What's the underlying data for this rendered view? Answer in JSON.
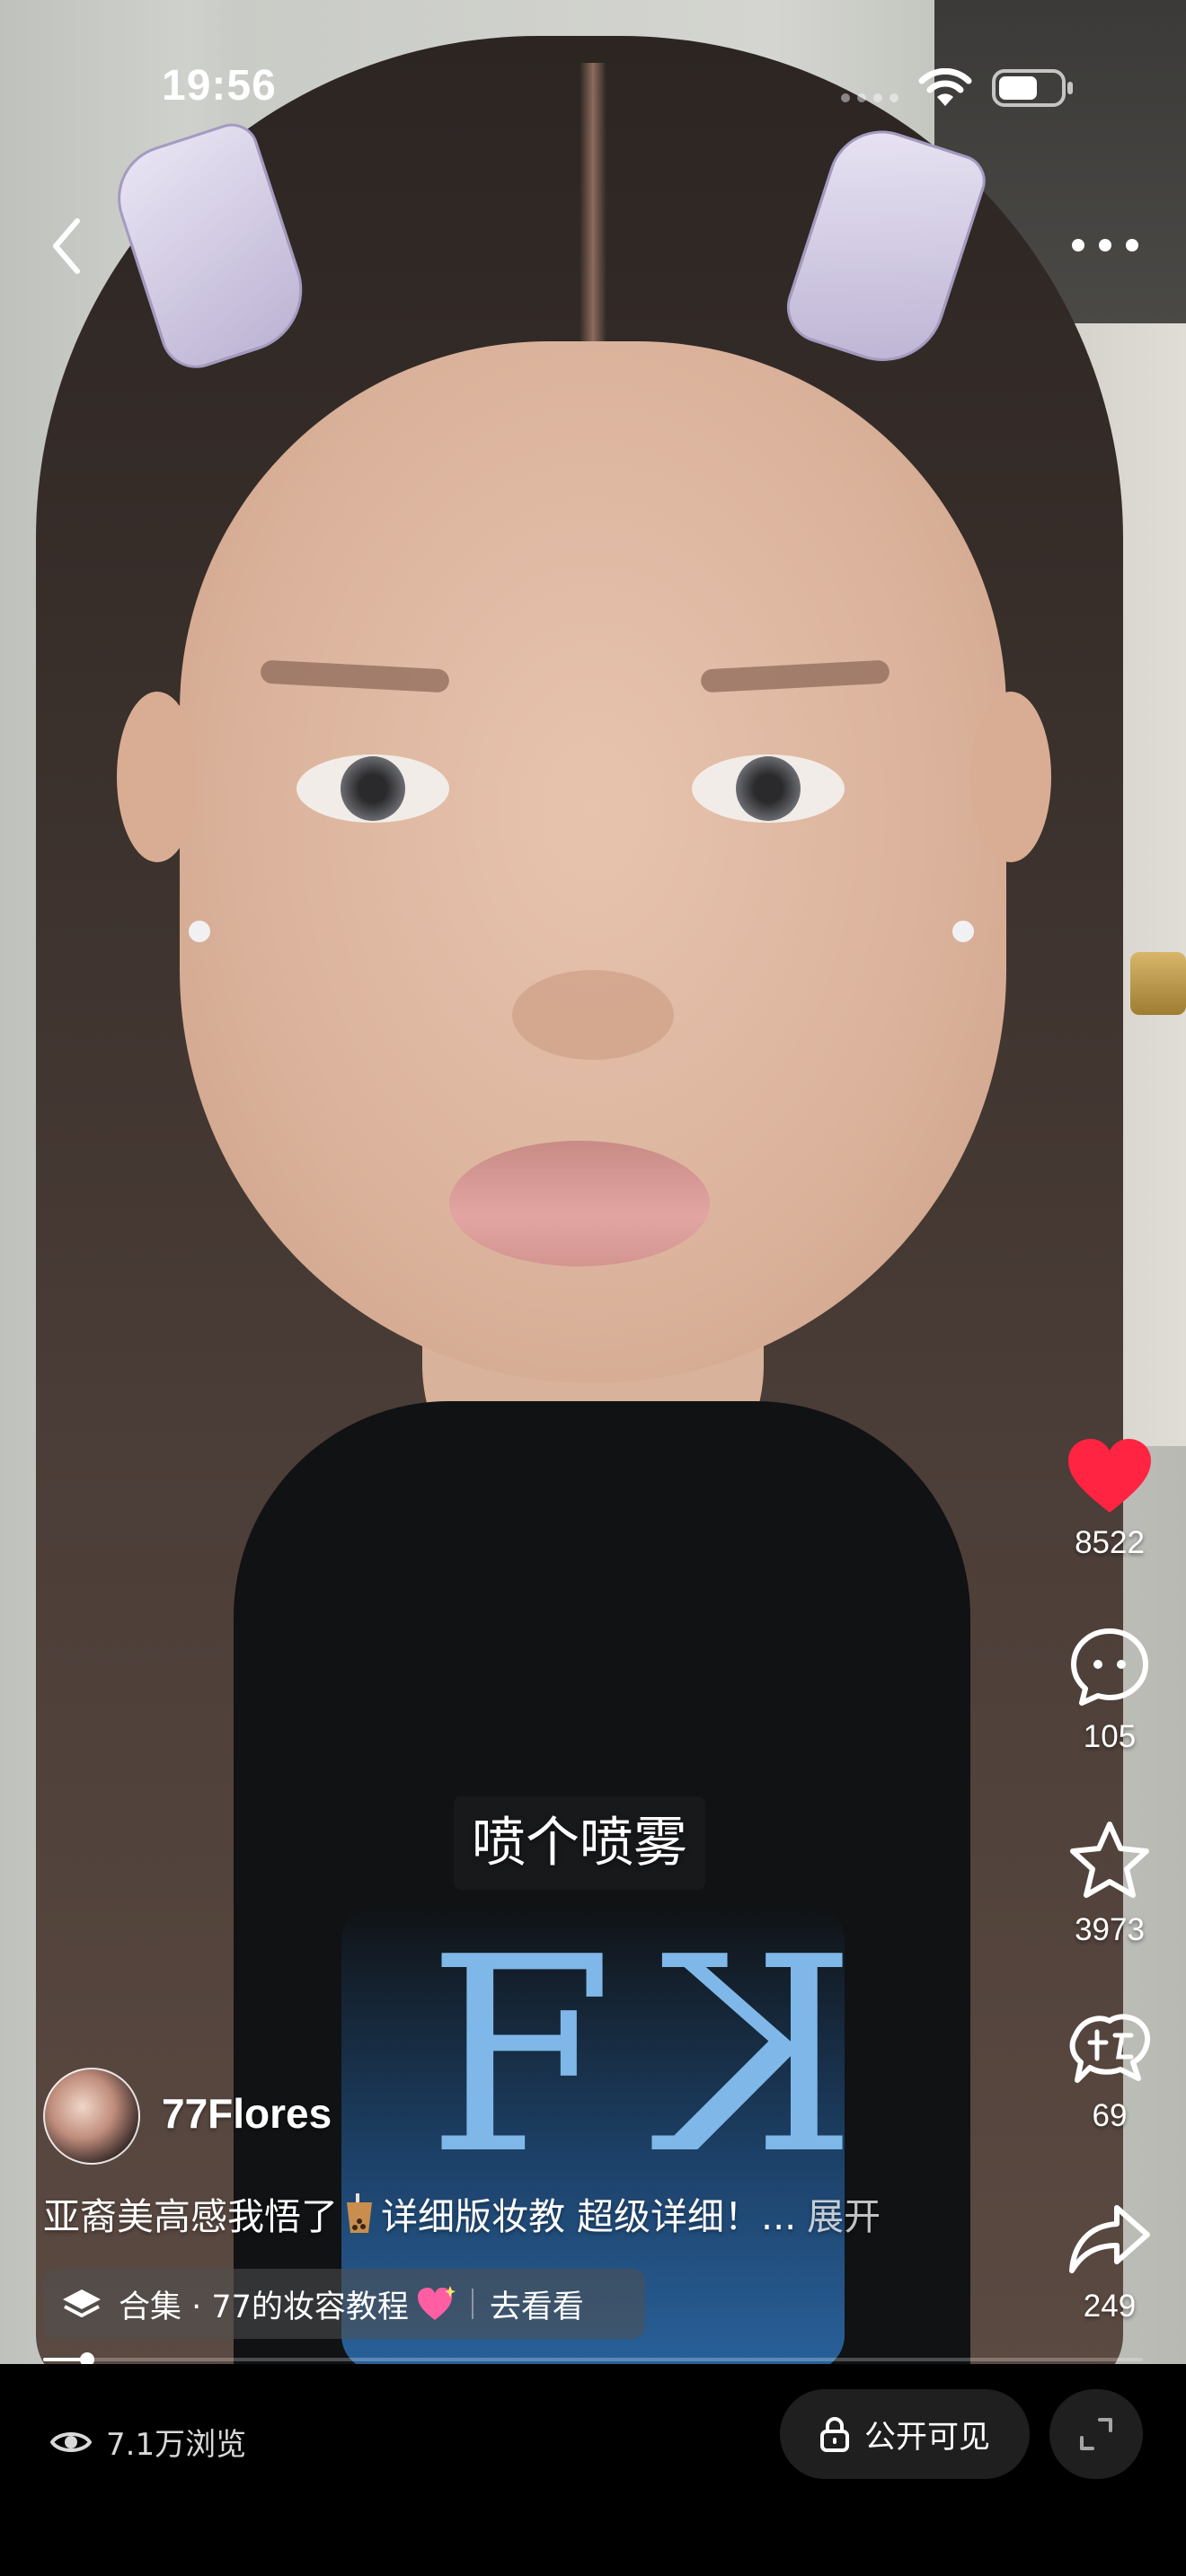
{
  "status_bar": {
    "time": "19:56",
    "icons": [
      "wifi-icon",
      "battery-icon"
    ]
  },
  "nav": {
    "back_icon": "chevron-left-icon",
    "more_icon": "more-horizontal-icon"
  },
  "actions": {
    "like": {
      "icon": "heart-icon",
      "count": "8522",
      "color": "#ff2442",
      "liked": true
    },
    "comment": {
      "icon": "comment-bubble-icon",
      "count": "105"
    },
    "favorite": {
      "icon": "star-icon",
      "count": "3973"
    },
    "remix": {
      "icon": "remix-icon",
      "count": "69"
    },
    "share": {
      "icon": "share-arrow-icon",
      "count": "249"
    }
  },
  "video": {
    "subtitle": "喷个喷雾",
    "progress": 0.04
  },
  "author": {
    "name": "77Flores"
  },
  "caption": {
    "text_before": "亚裔美高感我悟了",
    "inline_icon": "bubble-tea-icon",
    "text_after": "详细版妆教 超级详细！...",
    "expand": "展开"
  },
  "collection": {
    "icon": "layers-icon",
    "label": "合集 · 77的妆容教程",
    "emoji": "sparkling-heart-icon",
    "action": "去看看"
  },
  "bottom_bar": {
    "views_icon": "eye-icon",
    "views": "7.1万浏览",
    "privacy_icon": "lock-icon",
    "privacy": "公开可见",
    "expand_icon": "fullscreen-icon"
  }
}
